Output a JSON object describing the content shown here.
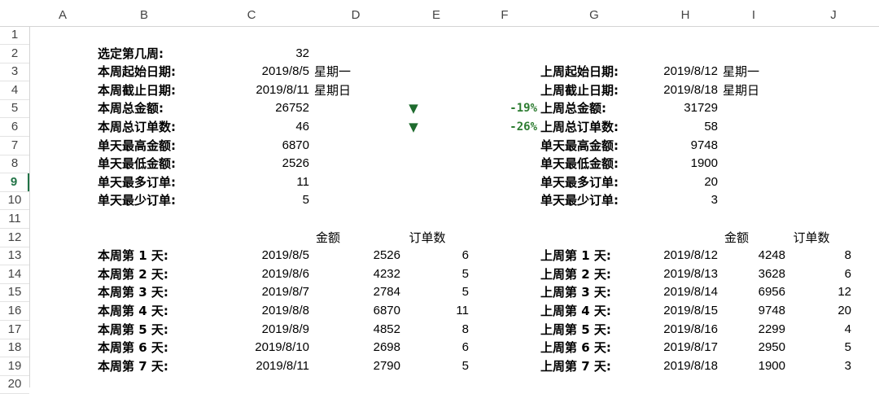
{
  "columns": [
    "A",
    "B",
    "C",
    "D",
    "E",
    "F",
    "G",
    "H",
    "I",
    "J"
  ],
  "rows": [
    "1",
    "2",
    "3",
    "4",
    "5",
    "6",
    "7",
    "8",
    "9",
    "10",
    "11",
    "12",
    "13",
    "14",
    "15",
    "16",
    "17",
    "18",
    "19",
    "20"
  ],
  "selected_row": "9",
  "colors": {
    "selected_header": "#217346",
    "down_arrow": "#1e6b2e",
    "pct_text": "#2e7d32"
  },
  "summary": {
    "week_select_label": "选定第几周:",
    "week_select_value": "32",
    "this_week": [
      {
        "label": "本周起始日期:",
        "value": "2019/8/5",
        "extra": "星期一"
      },
      {
        "label": "本周截止日期:",
        "value": "2019/8/11",
        "extra": "星期日"
      },
      {
        "label": "本周总金额:",
        "value": "26752",
        "extra": ""
      },
      {
        "label": "本周总订单数:",
        "value": "46",
        "extra": ""
      },
      {
        "label": "单天最高金额:",
        "value": "6870",
        "extra": ""
      },
      {
        "label": "单天最低金额:",
        "value": "2526",
        "extra": ""
      },
      {
        "label": "单天最多订单:",
        "value": "11",
        "extra": ""
      },
      {
        "label": "单天最少订单:",
        "value": "5",
        "extra": ""
      }
    ],
    "last_week": [
      {
        "label": "上周起始日期:",
        "value": "2019/8/12",
        "extra": "星期一"
      },
      {
        "label": "上周截止日期:",
        "value": "2019/8/18",
        "extra": "星期日"
      },
      {
        "label": "上周总金额:",
        "value": "31729",
        "extra": ""
      },
      {
        "label": "上周总订单数:",
        "value": "58",
        "extra": ""
      },
      {
        "label": "单天最高金额:",
        "value": "9748",
        "extra": ""
      },
      {
        "label": "单天最低金额:",
        "value": "1900",
        "extra": ""
      },
      {
        "label": "单天最多订单:",
        "value": "20",
        "extra": ""
      },
      {
        "label": "单天最少订单:",
        "value": "3",
        "extra": ""
      }
    ],
    "changes": [
      {
        "icon": "down-triangle-icon",
        "glyph": "▼",
        "pct": "-19%"
      },
      {
        "icon": "down-triangle-icon",
        "glyph": "▼",
        "pct": "-26%"
      }
    ]
  },
  "daily": {
    "amount_header": "金额",
    "orders_header": "订单数",
    "this_week": [
      {
        "label": "本周第 1 天:",
        "date": "2019/8/5",
        "amount": "2526",
        "orders": "6"
      },
      {
        "label": "本周第 2 天:",
        "date": "2019/8/6",
        "amount": "4232",
        "orders": "5"
      },
      {
        "label": "本周第 3 天:",
        "date": "2019/8/7",
        "amount": "2784",
        "orders": "5"
      },
      {
        "label": "本周第 4 天:",
        "date": "2019/8/8",
        "amount": "6870",
        "orders": "11"
      },
      {
        "label": "本周第 5 天:",
        "date": "2019/8/9",
        "amount": "4852",
        "orders": "8"
      },
      {
        "label": "本周第 6 天:",
        "date": "2019/8/10",
        "amount": "2698",
        "orders": "6"
      },
      {
        "label": "本周第 7 天:",
        "date": "2019/8/11",
        "amount": "2790",
        "orders": "5"
      }
    ],
    "last_week": [
      {
        "label": "上周第 1 天:",
        "date": "2019/8/12",
        "amount": "4248",
        "orders": "8"
      },
      {
        "label": "上周第 2 天:",
        "date": "2019/8/13",
        "amount": "3628",
        "orders": "6"
      },
      {
        "label": "上周第 3 天:",
        "date": "2019/8/14",
        "amount": "6956",
        "orders": "12"
      },
      {
        "label": "上周第 4 天:",
        "date": "2019/8/15",
        "amount": "9748",
        "orders": "20"
      },
      {
        "label": "上周第 5 天:",
        "date": "2019/8/16",
        "amount": "2299",
        "orders": "4"
      },
      {
        "label": "上周第 6 天:",
        "date": "2019/8/17",
        "amount": "2950",
        "orders": "5"
      },
      {
        "label": "上周第 7 天:",
        "date": "2019/8/18",
        "amount": "1900",
        "orders": "3"
      }
    ]
  }
}
